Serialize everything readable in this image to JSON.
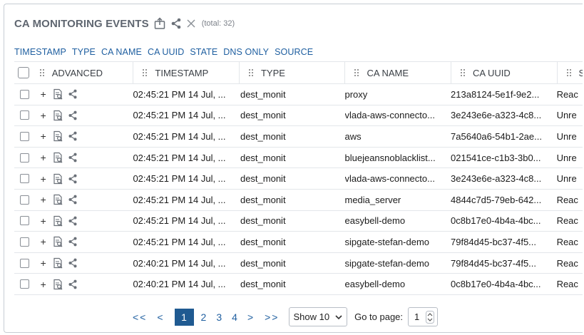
{
  "header": {
    "title": "CA MONITORING EVENTS",
    "total": "(total: 32)"
  },
  "filters": [
    "TIMESTAMP",
    "TYPE",
    "CA NAME",
    "CA UUID",
    "STATE",
    "DNS ONLY",
    "SOURCE"
  ],
  "columns": {
    "advanced": "ADVANCED",
    "timestamp": "TIMESTAMP",
    "type": "TYPE",
    "ca_name": "CA NAME",
    "ca_uuid": "CA UUID",
    "state": "S"
  },
  "rows": [
    {
      "timestamp": "02:45:21 PM 14 Jul, ...",
      "type": "dest_monit",
      "ca_name": "proxy",
      "ca_uuid": "213a8124-5e1f-9e2...",
      "state": "Reac"
    },
    {
      "timestamp": "02:45:21 PM 14 Jul, ...",
      "type": "dest_monit",
      "ca_name": "vlada-aws-connecto...",
      "ca_uuid": "3e243e6e-a323-4c8...",
      "state": "Unre"
    },
    {
      "timestamp": "02:45:21 PM 14 Jul, ...",
      "type": "dest_monit",
      "ca_name": "aws",
      "ca_uuid": "7a5640a6-54b1-2ae...",
      "state": "Unre"
    },
    {
      "timestamp": "02:45:21 PM 14 Jul, ...",
      "type": "dest_monit",
      "ca_name": "bluejeansnoblacklist...",
      "ca_uuid": "021541ce-c1b3-3b0...",
      "state": "Unre"
    },
    {
      "timestamp": "02:45:21 PM 14 Jul, ...",
      "type": "dest_monit",
      "ca_name": "vlada-aws-connecto...",
      "ca_uuid": "3e243e6e-a323-4c8...",
      "state": "Unre"
    },
    {
      "timestamp": "02:45:21 PM 14 Jul, ...",
      "type": "dest_monit",
      "ca_name": "media_server",
      "ca_uuid": "4844c7d5-79eb-642...",
      "state": "Reac"
    },
    {
      "timestamp": "02:45:21 PM 14 Jul, ...",
      "type": "dest_monit",
      "ca_name": "easybell-demo",
      "ca_uuid": "0c8b17e0-4b4a-4bc...",
      "state": "Reac"
    },
    {
      "timestamp": "02:45:21 PM 14 Jul, ...",
      "type": "dest_monit",
      "ca_name": "sipgate-stefan-demo",
      "ca_uuid": "79f84d45-bc37-4f5...",
      "state": "Reac"
    },
    {
      "timestamp": "02:40:21 PM 14 Jul, ...",
      "type": "dest_monit",
      "ca_name": "sipgate-stefan-demo",
      "ca_uuid": "79f84d45-bc37-4f5...",
      "state": "Reac"
    },
    {
      "timestamp": "02:40:21 PM 14 Jul, ...",
      "type": "dest_monit",
      "ca_name": "easybell-demo",
      "ca_uuid": "0c8b17e0-4b4a-4bc...",
      "state": "Reac"
    }
  ],
  "row_plus": "+",
  "pagination": {
    "first": "<<",
    "prev": "<",
    "pages": [
      "1",
      "2",
      "3",
      "4"
    ],
    "active_page": "1",
    "next": ">",
    "last": ">>",
    "page_size": "Show 10",
    "goto_label": "Go to page:",
    "goto_value": "1"
  },
  "icons": {
    "export": "export-icon",
    "share": "share-icon",
    "close": "close-icon",
    "details": "details-icon",
    "grip": "drag-grip-icon",
    "chevron": "chevron-down-icon",
    "spinner": "number-spinner-icon"
  },
  "colors": {
    "link": "#1f5fa0",
    "active_page_bg": "#1f5a91",
    "title": "#5f6670",
    "border": "#e3e6ea"
  }
}
